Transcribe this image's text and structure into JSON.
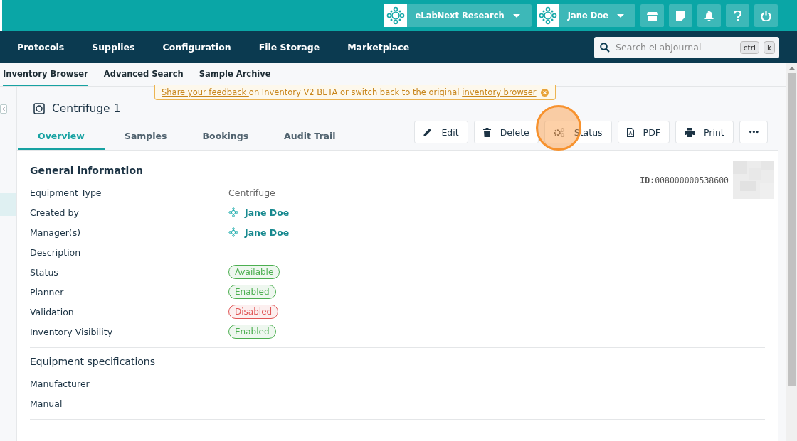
{
  "topbar": {
    "org": "eLabNext Research",
    "user": "Jane Doe"
  },
  "nav": {
    "items": [
      "Protocols",
      "Supplies",
      "Configuration",
      "File Storage",
      "Marketplace"
    ],
    "search": {
      "placeholder": "Search eLabJournal",
      "keys": [
        "ctrl",
        "k"
      ]
    }
  },
  "subnav": [
    {
      "label": "Inventory Browser",
      "selected": true
    },
    {
      "label": "Advanced Search",
      "selected": false
    },
    {
      "label": "Sample Archive",
      "selected": false
    }
  ],
  "banner": [
    {
      "kind": "link",
      "text": "Share your feedback "
    },
    {
      "kind": "text",
      "text": "on Inventory V2 BETA or switch back to the original "
    },
    {
      "kind": "link",
      "text": "inventory browser"
    }
  ],
  "item": {
    "title": "Centrifuge 1",
    "id_label": "ID:",
    "id": "008000000538600"
  },
  "tabs": [
    {
      "label": "Overview",
      "selected": true
    },
    {
      "label": "Samples",
      "selected": false
    },
    {
      "label": "Bookings",
      "selected": false
    },
    {
      "label": "Audit Trail",
      "selected": false
    }
  ],
  "actions": [
    {
      "kind": "edit",
      "label": "Edit",
      "highlighted": false
    },
    {
      "kind": "delete",
      "label": "Delete",
      "highlighted": false
    },
    {
      "kind": "status",
      "label": "Status",
      "highlighted": true
    },
    {
      "kind": "pdf",
      "label": "PDF",
      "highlighted": false
    },
    {
      "kind": "print",
      "label": "Print",
      "highlighted": false
    },
    {
      "kind": "more",
      "label": "•••",
      "highlighted": false
    }
  ],
  "sections": [
    {
      "title": "General information",
      "fields": [
        {
          "label": "Equipment Type",
          "kind": "text",
          "value": "Centrifuge"
        },
        {
          "label": "Created by",
          "kind": "user",
          "value": "Jane Doe"
        },
        {
          "label": "Manager(s)",
          "kind": "user",
          "value": "Jane Doe"
        },
        {
          "label": "Description",
          "kind": "empty"
        },
        {
          "label": "Status",
          "kind": "badge",
          "value": "Available",
          "color": "#4caf50"
        },
        {
          "label": "Planner",
          "kind": "badge",
          "value": "Enabled",
          "color": "#4caf50"
        },
        {
          "label": "Validation",
          "kind": "badge",
          "value": "Disabled",
          "color": "#e05555"
        },
        {
          "label": "Inventory Visibility",
          "kind": "badge",
          "value": "Enabled",
          "color": "#4caf50"
        }
      ]
    },
    {
      "title": "Equipment specifications",
      "fields": [
        {
          "label": "Manufacturer",
          "kind": "empty"
        },
        {
          "label": "Manual",
          "kind": "empty"
        }
      ]
    }
  ]
}
